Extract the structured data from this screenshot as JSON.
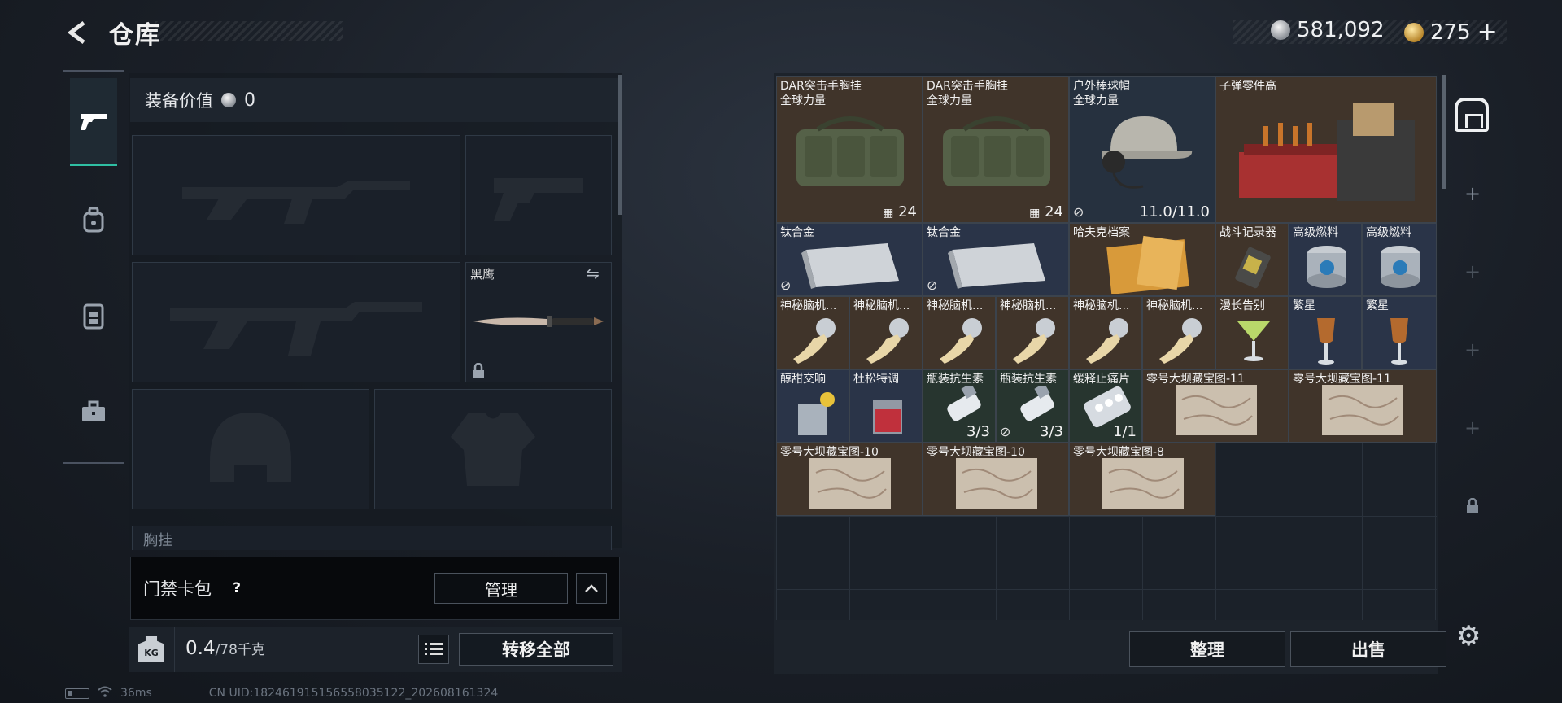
{
  "header": {
    "title": "仓库"
  },
  "currency": {
    "silver": "581,092",
    "gold": "275",
    "gold_add": "+"
  },
  "equipment": {
    "value_label": "装备价值",
    "value": "0",
    "knife_name": "黑鹰",
    "vest_label": "胸挂"
  },
  "card_pack": {
    "label": "门禁卡包",
    "help": "?",
    "manage": "管理"
  },
  "weight": {
    "kg_badge": "KG",
    "current": "0.4",
    "max": "/78千克"
  },
  "actions": {
    "transfer_all": "转移全部",
    "sort": "整理",
    "sell": "出售"
  },
  "status_bar": {
    "ping": "36ms",
    "uid": "CN UID:182461915156558035122_202608161324"
  },
  "items": [
    {
      "name": "DAR突击手胸挂\n全球力量",
      "count": "24",
      "count_icon": "slots"
    },
    {
      "name": "DAR突击手胸挂\n全球力量",
      "count": "24",
      "count_icon": "slots"
    },
    {
      "name": "户外棒球帽\n全球力量",
      "count": "11.0/11.0",
      "count_icon": "durability"
    },
    {
      "name": "子弹零件高",
      "count": ""
    },
    {
      "name": "钛合金",
      "count": ""
    },
    {
      "name": "钛合金",
      "count": ""
    },
    {
      "name": "哈夫克档案",
      "count": ""
    },
    {
      "name": "战斗记录器",
      "count": ""
    },
    {
      "name": "高级燃料",
      "count": ""
    },
    {
      "name": "高级燃料",
      "count": ""
    },
    {
      "name": "神秘脑机...",
      "count": ""
    },
    {
      "name": "神秘脑机...",
      "count": ""
    },
    {
      "name": "神秘脑机...",
      "count": ""
    },
    {
      "name": "神秘脑机...",
      "count": ""
    },
    {
      "name": "神秘脑机...",
      "count": ""
    },
    {
      "name": "神秘脑机...",
      "count": ""
    },
    {
      "name": "漫长告别",
      "count": ""
    },
    {
      "name": "繁星",
      "count": ""
    },
    {
      "name": "繁星",
      "count": ""
    },
    {
      "name": "醇甜交响",
      "count": ""
    },
    {
      "name": "杜松特调",
      "count": ""
    },
    {
      "name": "瓶装抗生素",
      "count": "3/3"
    },
    {
      "name": "瓶装抗生素",
      "count": "3/3"
    },
    {
      "name": "缓释止痛片",
      "count": "1/1"
    },
    {
      "name": "零号大坝藏宝图-11",
      "count": ""
    },
    {
      "name": "零号大坝藏宝图-11",
      "count": ""
    },
    {
      "name": "零号大坝藏宝图-10",
      "count": ""
    },
    {
      "name": "零号大坝藏宝图-10",
      "count": ""
    },
    {
      "name": "零号大坝藏宝图-8",
      "count": ""
    }
  ],
  "colors": {
    "accent": "#2fbfa3",
    "slot_bg": "#1a2029",
    "item_brown": "#40342a",
    "item_blue": "#2a3448"
  }
}
